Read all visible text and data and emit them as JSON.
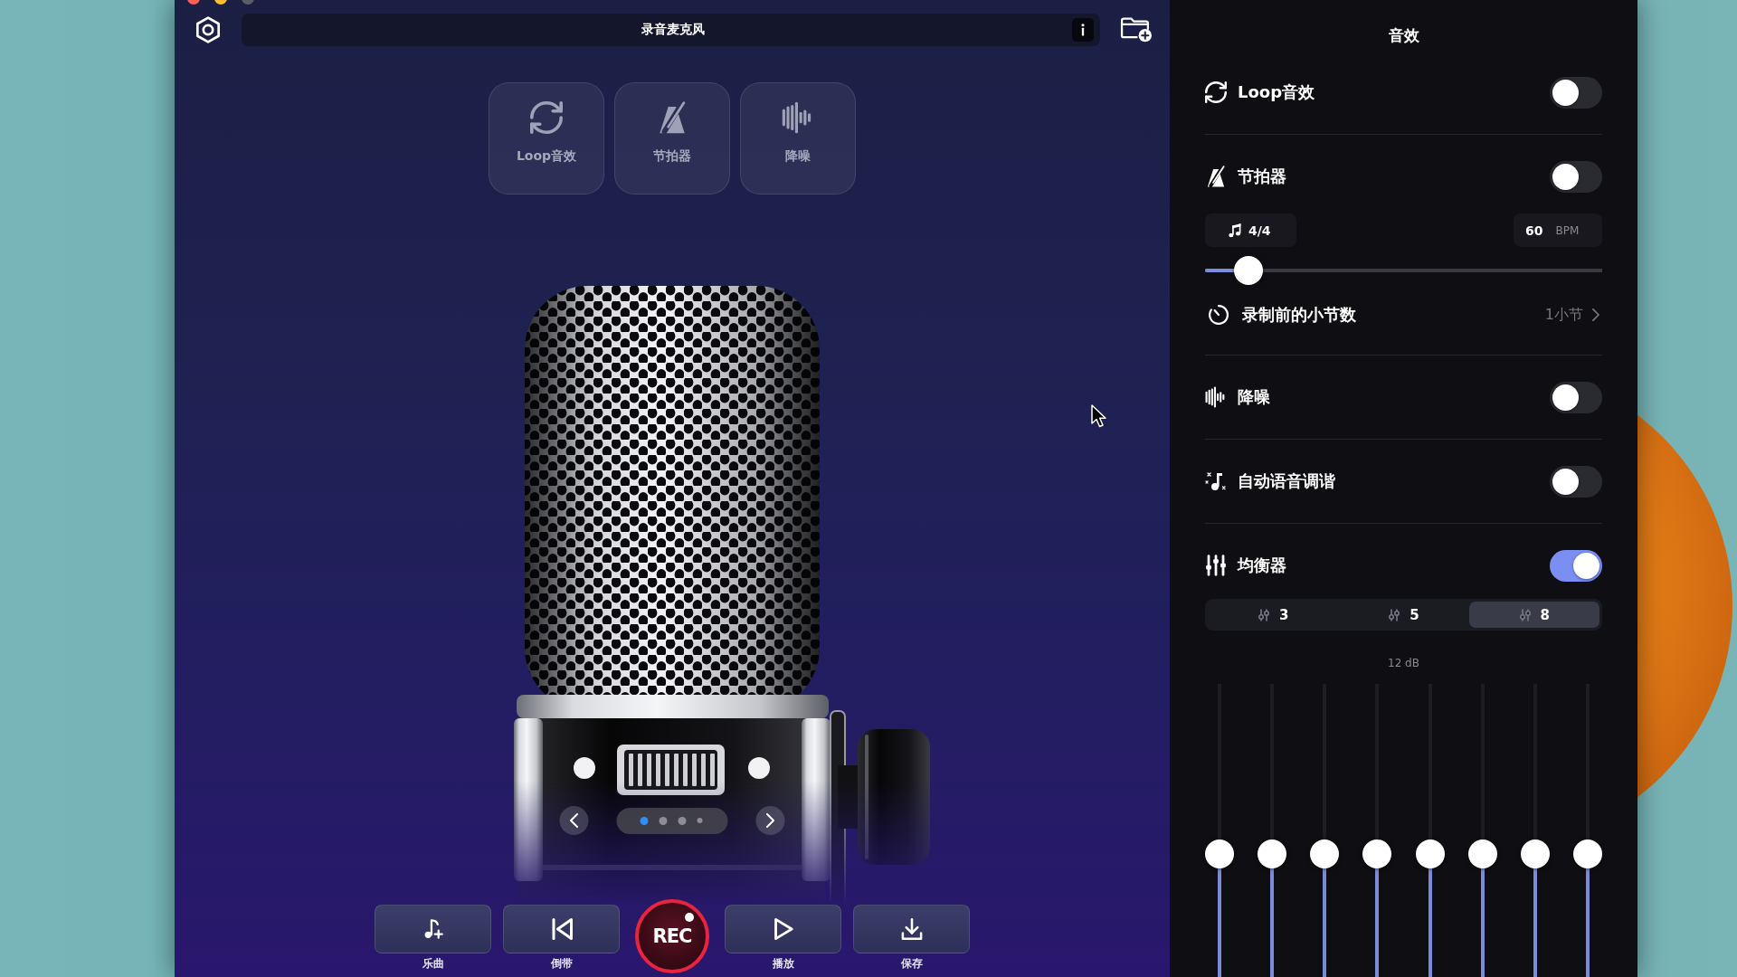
{
  "window": {
    "title": "录音麦克风"
  },
  "effect_tiles": [
    {
      "kind": "loop",
      "label": "Loop音效"
    },
    {
      "kind": "metronome",
      "label": "节拍器"
    },
    {
      "kind": "denoise",
      "label": "降噪"
    }
  ],
  "pager": {
    "pages": [
      {
        "selected": true
      },
      {
        "selected": false
      },
      {
        "selected": false
      },
      {
        "selected": false
      }
    ]
  },
  "transport": [
    {
      "kind": "song",
      "label": "乐曲"
    },
    {
      "kind": "rewind",
      "label": "倒带"
    },
    {
      "kind": "record",
      "label": "REC"
    },
    {
      "kind": "play",
      "label": "播放"
    },
    {
      "kind": "save",
      "label": "保存"
    }
  ],
  "effects_panel": {
    "title": "音效",
    "effects": [
      {
        "kind": "loop",
        "label": "Loop音效",
        "on": false
      },
      {
        "kind": "metronome",
        "label": "节拍器",
        "on": false,
        "tempo": {
          "time_signature": "4/4",
          "bpm": "60",
          "unit": "BPM",
          "level": 0.11
        },
        "count_in": {
          "label": "录制前的小节数",
          "value": "1小节"
        }
      },
      {
        "kind": "denoise",
        "label": "降噪",
        "on": false
      },
      {
        "kind": "autotune",
        "label": "自动语音调谐",
        "on": false
      },
      {
        "kind": "equalizer",
        "label": "均衡器",
        "on": true,
        "band_options": [
          {
            "label": "3",
            "selected": false
          },
          {
            "label": "5",
            "selected": false
          },
          {
            "label": "8",
            "selected": true
          }
        ],
        "scale_label": "12 dB",
        "bands": [
          {
            "level": 0.42
          },
          {
            "level": 0.42
          },
          {
            "level": 0.42
          },
          {
            "level": 0.42
          },
          {
            "level": 0.42
          },
          {
            "level": 0.42
          },
          {
            "level": 0.42
          },
          {
            "level": 0.42
          }
        ]
      }
    ]
  }
}
